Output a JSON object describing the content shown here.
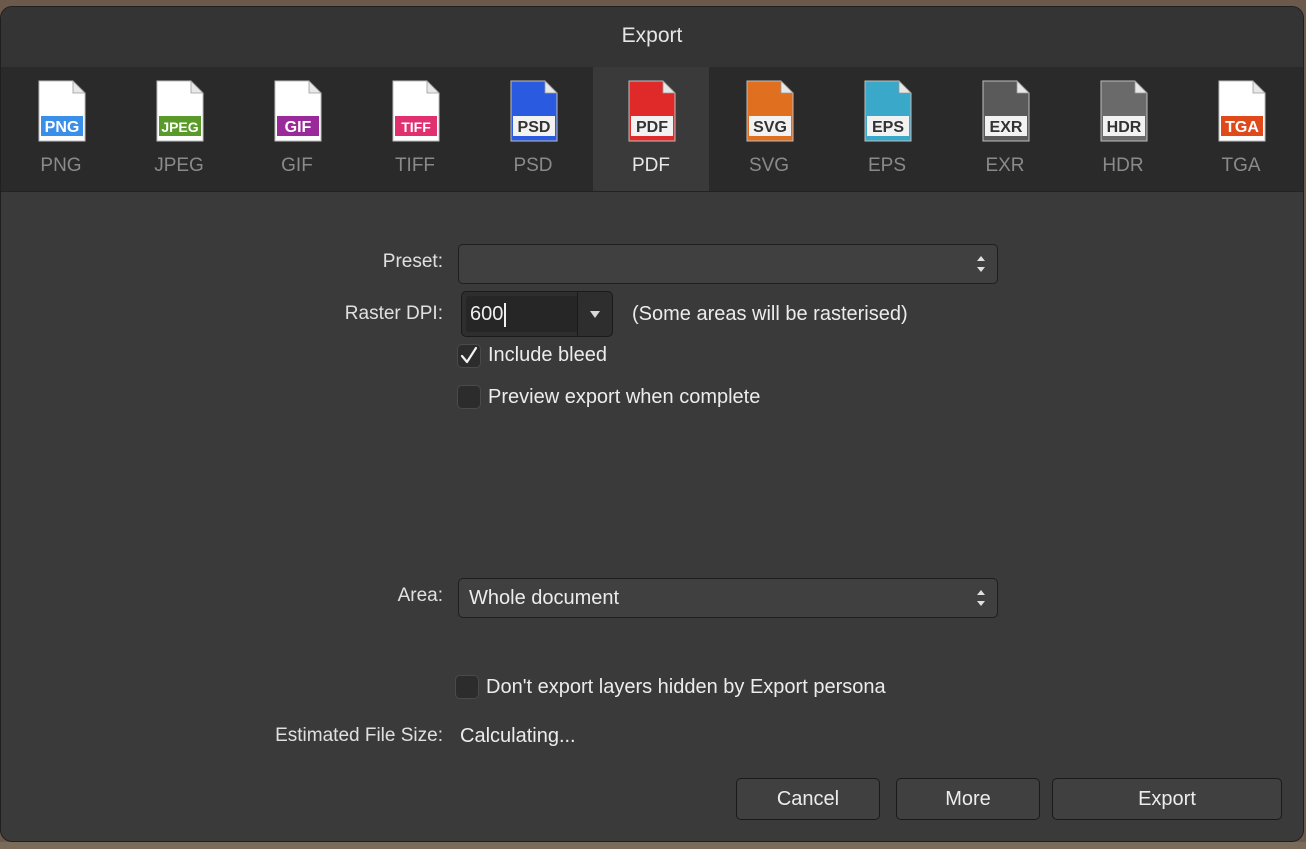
{
  "dialog": {
    "title": "Export"
  },
  "formats": [
    {
      "label": "PNG",
      "badge": "PNG",
      "color": "#3a8fe8",
      "active": false
    },
    {
      "label": "JPEG",
      "badge": "JPEG",
      "color": "#5a9a2a",
      "active": false
    },
    {
      "label": "GIF",
      "badge": "GIF",
      "color": "#9a2a9a",
      "active": false
    },
    {
      "label": "TIFF",
      "badge": "TIFF",
      "color": "#e03070",
      "active": false
    },
    {
      "label": "PSD",
      "badge": "PSD",
      "color": "#2a5ae0",
      "active": false
    },
    {
      "label": "PDF",
      "badge": "PDF",
      "color": "#e02a2a",
      "active": true
    },
    {
      "label": "SVG",
      "badge": "SVG",
      "color": "#e07020",
      "active": false
    },
    {
      "label": "EPS",
      "badge": "EPS",
      "color": "#3aa8c8",
      "active": false
    },
    {
      "label": "EXR",
      "badge": "EXR",
      "color": "#5a5a5a",
      "active": false
    },
    {
      "label": "HDR",
      "badge": "HDR",
      "color": "#6a6a6a",
      "active": false
    },
    {
      "label": "TGA",
      "badge": "TGA",
      "color": "#e04a1a",
      "active": false
    }
  ],
  "preset": {
    "label": "Preset:",
    "value": ""
  },
  "raster_dpi": {
    "label": "Raster DPI:",
    "value": "600",
    "note": "(Some areas will be rasterised)"
  },
  "include_bleed": {
    "label": "Include bleed",
    "checked": true
  },
  "preview_export": {
    "label": "Preview export when complete",
    "checked": false
  },
  "area": {
    "label": "Area:",
    "value": "Whole document"
  },
  "hidden_layers": {
    "label": "Don't export layers hidden by Export persona",
    "checked": false
  },
  "file_size": {
    "label": "Estimated File Size:",
    "value": "Calculating..."
  },
  "buttons": {
    "cancel": "Cancel",
    "more": "More",
    "export": "Export"
  }
}
